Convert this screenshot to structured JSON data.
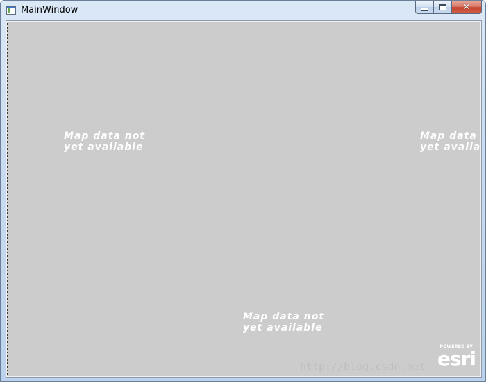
{
  "window": {
    "title": "MainWindow",
    "icon": "app-window-icon",
    "controls": {
      "minimize_icon": "minimize-icon",
      "maximize_icon": "maximize-icon",
      "close_icon": "close-icon",
      "close_glyph": "✕"
    }
  },
  "map": {
    "background_color": "#cccccc",
    "tiles": [
      {
        "line1": "Map data not",
        "line2": "yet available"
      },
      {
        "line1": "Map data not",
        "line2": "yet available"
      },
      {
        "line1": "Map data not",
        "line2": "yet available"
      }
    ],
    "attribution": {
      "powered_by": "POWERED BY",
      "brand": "esri"
    },
    "watermark": "http://blog.csdn.net"
  }
}
